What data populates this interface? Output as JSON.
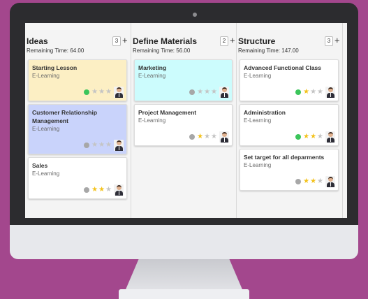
{
  "colors": {
    "background": "#a3478d",
    "card_yellow": "#fcefc4",
    "card_cyan": "#ccfcfd",
    "card_blue": "#c9d3fb",
    "card_white": "#ffffff",
    "dot_green": "#3bc55b",
    "dot_gray": "#a7a7a7",
    "star_gold": "#f3c21b",
    "star_empty": "#c4c4c4"
  },
  "columns": [
    {
      "title": "Ideas",
      "count": "3",
      "add": "+",
      "remaining": "Remaining Time: 64.00",
      "cards": [
        {
          "title": "Starting Lesson",
          "tag": "E-Learning",
          "color": "#fcefc4",
          "dot": "#3bc55b",
          "stars": 0
        },
        {
          "title": "Customer Relationship Management",
          "tag": "E-Learning",
          "color": "#c9d3fb",
          "dot": "#a7a7a7",
          "stars": 0
        },
        {
          "title": "Sales",
          "tag": "E-Learning",
          "color": "#ffffff",
          "dot": "#a7a7a7",
          "stars": 2
        }
      ]
    },
    {
      "title": "Define Materials",
      "count": "2",
      "add": "+",
      "remaining": "Remaining Time: 56.00",
      "cards": [
        {
          "title": "Marketing",
          "tag": "E-Learning",
          "color": "#ccfcfd",
          "dot": "#a7a7a7",
          "stars": 0
        },
        {
          "title": "Project Management",
          "tag": "E-Learning",
          "color": "#ffffff",
          "dot": "#a7a7a7",
          "stars": 1
        }
      ]
    },
    {
      "title": "Structure",
      "count": "3",
      "add": "+",
      "remaining": "Remaining Time: 147.00",
      "cards": [
        {
          "title": "Advanced Functional Class",
          "tag": "E-Learning",
          "color": "#ffffff",
          "dot": "#3bc55b",
          "stars": 1
        },
        {
          "title": "Administration",
          "tag": "E-Learning",
          "color": "#ffffff",
          "dot": "#3bc55b",
          "stars": 2
        },
        {
          "title": "Set target for all deparments",
          "tag": "E-Learning",
          "color": "#ffffff",
          "dot": "#a7a7a7",
          "stars": 2
        }
      ]
    }
  ],
  "icons": {
    "star": "star-icon",
    "avatar": "user-avatar",
    "status": "status-dot-icon"
  }
}
